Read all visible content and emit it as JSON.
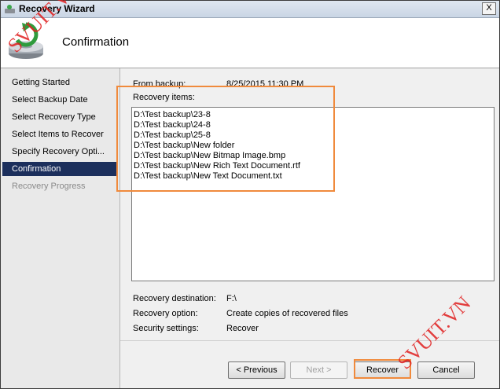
{
  "window": {
    "title": "Recovery Wizard",
    "close_label": "X"
  },
  "header": {
    "title": "Confirmation"
  },
  "sidebar": {
    "items": [
      {
        "label": "Getting Started"
      },
      {
        "label": "Select Backup Date"
      },
      {
        "label": "Select Recovery Type"
      },
      {
        "label": "Select Items to Recover"
      },
      {
        "label": "Specify Recovery Opti..."
      },
      {
        "label": "Confirmation"
      },
      {
        "label": "Recovery Progress"
      }
    ]
  },
  "main": {
    "from_backup_label": "From backup:",
    "from_backup_value": "8/25/2015 11:30 PM",
    "recovery_items_label": "Recovery items:",
    "recovery_items": [
      "D:\\Test backup\\23-8",
      "D:\\Test backup\\24-8",
      "D:\\Test backup\\25-8",
      "D:\\Test backup\\New folder",
      "D:\\Test backup\\New Bitmap Image.bmp",
      "D:\\Test backup\\New Rich Text Document.rtf",
      "D:\\Test backup\\New Text Document.txt"
    ],
    "recovery_destination_label": "Recovery destination:",
    "recovery_destination_value": "F:\\",
    "recovery_option_label": "Recovery option:",
    "recovery_option_value": "Create copies of recovered files",
    "security_settings_label": "Security settings:",
    "security_settings_value": "Recover"
  },
  "buttons": {
    "previous": "< Previous",
    "next": "Next >",
    "recover": "Recover",
    "cancel": "Cancel"
  },
  "watermarks": {
    "top_left": "SVUIT.VN",
    "bottom_right": "SVUIT.VN"
  },
  "colors": {
    "highlight": "#f08a3c",
    "active_nav": "#1c2f5c",
    "watermark": "#e02020"
  }
}
